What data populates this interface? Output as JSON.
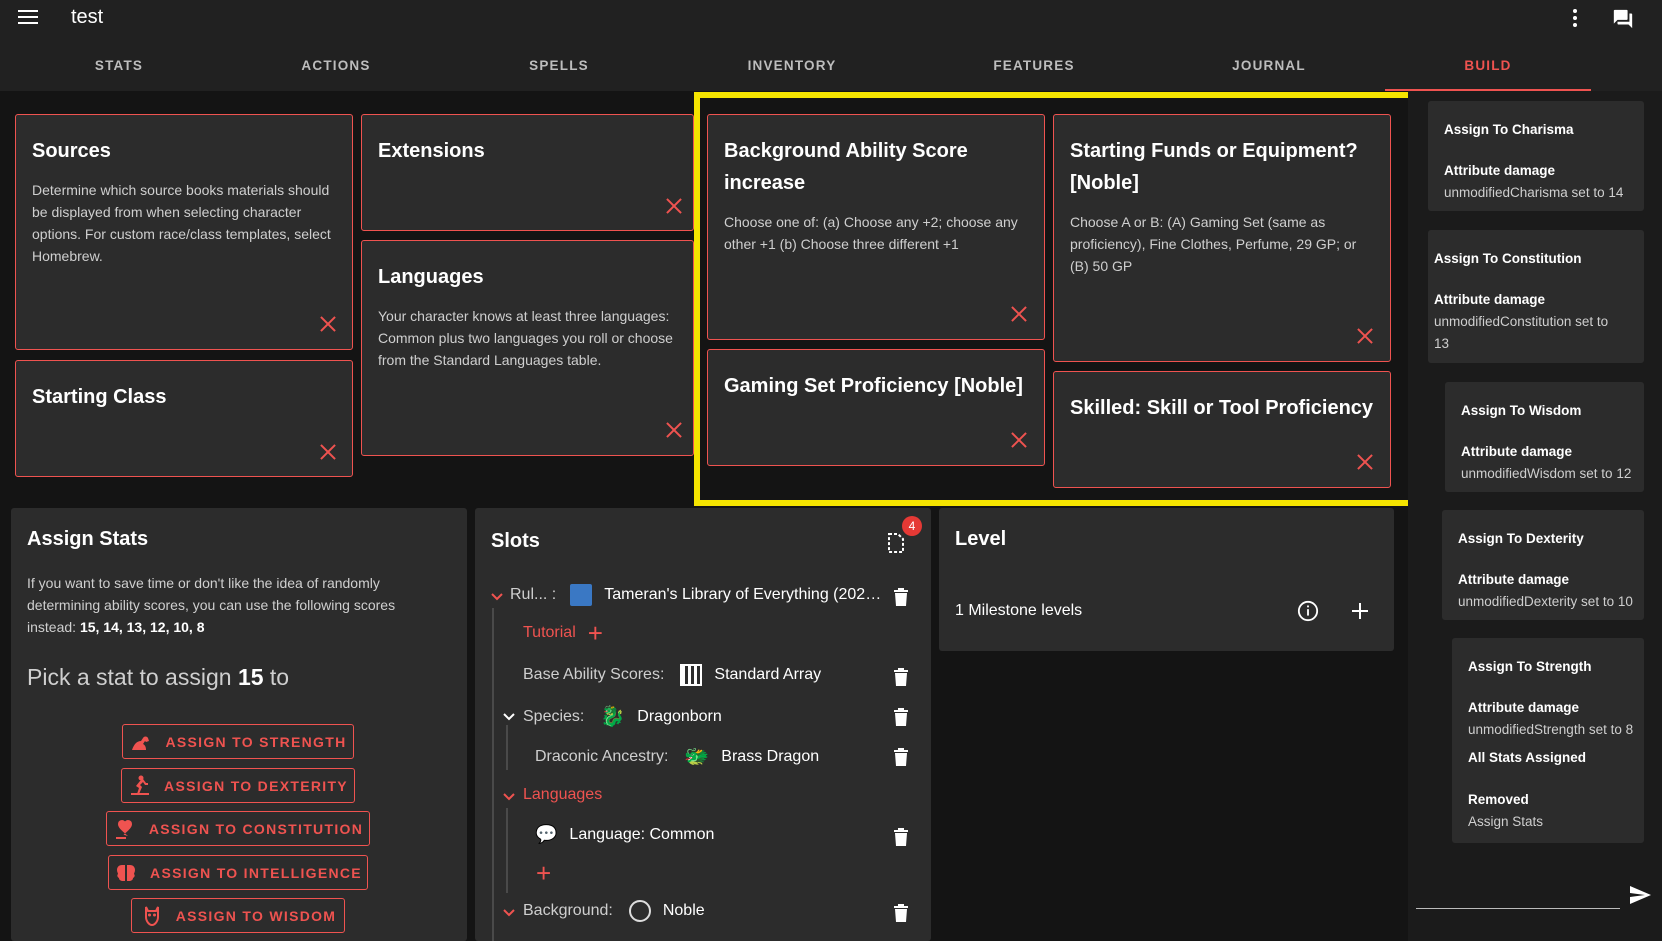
{
  "app": {
    "title": "test"
  },
  "tabs": [
    {
      "label": "STATS"
    },
    {
      "label": "ACTIONS"
    },
    {
      "label": "SPELLS"
    },
    {
      "label": "INVENTORY"
    },
    {
      "label": "FEATURES"
    },
    {
      "label": "JOURNAL"
    },
    {
      "label": "BUILD",
      "active": true
    }
  ],
  "cards": {
    "sources": {
      "title": "Sources",
      "text": "Determine which source books materials should be displayed from when selecting character options. For custom race/class templates, select Homebrew."
    },
    "extensions": {
      "title": "Extensions"
    },
    "starting_class": {
      "title": "Starting Class"
    },
    "languages": {
      "title": "Languages",
      "text": "Your character knows at least three languages: Common plus two languages you roll or choose from the Standard Languages table."
    },
    "background_asi": {
      "title_1": "Background Ability Score",
      "title_2": "increase",
      "text": "Choose one of: (a) Choose any +2; choose any other +1 (b) Choose three different +1"
    },
    "gaming_set": {
      "title": "Gaming Set Proficiency [Noble]"
    },
    "starting_funds": {
      "title_1": "Starting Funds or Equipment?",
      "title_2": "[Noble]",
      "text": "Choose A or B: (A) Gaming Set (same as proficiency), Fine Clothes, Perfume, 29 GP; or (B) 50 GP"
    },
    "skilled": {
      "title": "Skilled: Skill or Tool Proficiency"
    }
  },
  "assign_stats": {
    "title": "Assign Stats",
    "text": "If you want to save time or don't like the idea of randomly determining ability scores, you can use the following scores instead: ",
    "scores": "15, 14, 13, 12, 10, 8",
    "pick_prefix": "Pick a stat to assign ",
    "pick_value": "15",
    "pick_suffix": " to",
    "buttons": [
      {
        "label": "ASSIGN TO STRENGTH",
        "icon": "strength-icon"
      },
      {
        "label": "ASSIGN TO DEXTERITY",
        "icon": "dexterity-icon"
      },
      {
        "label": "ASSIGN TO CONSTITUTION",
        "icon": "constitution-icon"
      },
      {
        "label": "ASSIGN TO INTELLIGENCE",
        "icon": "intelligence-icon"
      },
      {
        "label": "ASSIGN TO WISDOM",
        "icon": "wisdom-icon"
      }
    ]
  },
  "slots": {
    "title": "Slots",
    "badge": "4",
    "rules_label": "Rul... :",
    "rules_value": "Tameran's Library of Everything (2024...",
    "tutorial": "Tutorial",
    "base_label": "Base Ability Scores:",
    "base_value": "Standard Array",
    "species_label": "Species:",
    "species_value": "Dragonborn",
    "ancestry_label": "Draconic Ancestry:",
    "ancestry_value": "Brass Dragon",
    "languages_label": "Languages",
    "language_value": "Language: Common",
    "background_label": "Background:",
    "background_value": "Noble"
  },
  "level": {
    "title": "Level",
    "row": "1 Milestone levels"
  },
  "log": [
    {
      "title": "Assign To Charisma",
      "sub": "Attribute damage",
      "detail": "unmodifiedCharisma set to 14"
    },
    {
      "title": "Assign To Constitution",
      "sub": "Attribute damage",
      "detail_1": "unmodifiedConstitution set to",
      "detail_2": "13"
    },
    {
      "title": "Assign To Wisdom",
      "sub": "Attribute damage",
      "detail": "unmodifiedWisdom set to 12"
    },
    {
      "title": "Assign To Dexterity",
      "sub": "Attribute damage",
      "detail": "unmodifiedDexterity set to 10"
    },
    {
      "title": "Assign To Strength",
      "sub": "Attribute damage",
      "detail": "unmodifiedStrength set to 8",
      "extra": "All Stats Assigned",
      "removed": "Removed",
      "removed_detail": "Assign Stats"
    }
  ],
  "colors": {
    "accent": "#ef5350",
    "highlight": "#f5e400",
    "card": "#2c2c2c",
    "bg": "#141414"
  }
}
